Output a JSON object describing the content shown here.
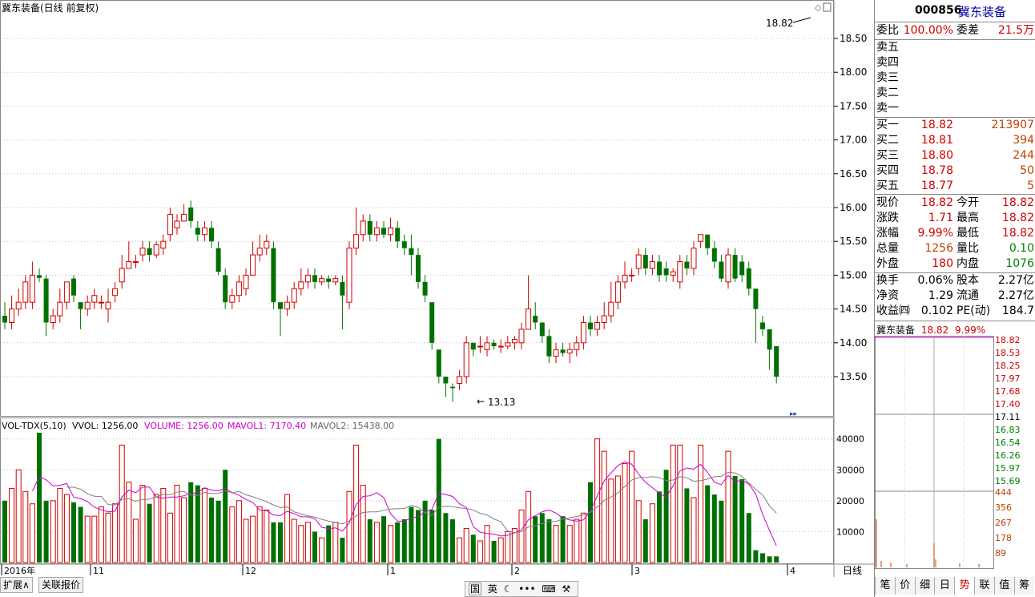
{
  "chart_title": "冀东装备(日线 前复权)",
  "vol_header": {
    "indicator": "VOL-TDX(5,10)",
    "vvol": "VVOL: 1256.00",
    "volume": "VOLUME: 1256.00",
    "mavol1": "MAVOL1: 7170.40",
    "mavol2": "MAVOL2: 15438.00"
  },
  "colors": {
    "up": "#d00000",
    "down": "#007000",
    "ma1": "#cc00cc",
    "ma2": "#808080",
    "grid": "#bfbfbf"
  },
  "price_axis": [
    "18.50",
    "18.00",
    "17.50",
    "17.00",
    "16.50",
    "16.00",
    "15.50",
    "15.00",
    "14.50",
    "14.00",
    "13.50"
  ],
  "vol_axis": [
    "40000",
    "30000",
    "20000",
    "10000"
  ],
  "time_axis": [
    "2016年",
    "11",
    "12",
    "1",
    "2",
    "3",
    "4"
  ],
  "period_label": "日线",
  "annotations": {
    "high": "18.82",
    "low": "13.13"
  },
  "chart_data": {
    "type": "candlestick",
    "ylim": [
      13.1,
      18.9
    ],
    "candles": [
      [
        14.4,
        14.3,
        14.6,
        14.2
      ],
      [
        14.3,
        14.5,
        14.7,
        14.2
      ],
      [
        14.5,
        14.6,
        14.8,
        14.4
      ],
      [
        14.6,
        14.9,
        15.0,
        14.5
      ],
      [
        14.6,
        15.0,
        15.2,
        14.5
      ],
      [
        15.0,
        14.96,
        15.1,
        14.9
      ],
      [
        14.95,
        14.3,
        15.0,
        14.1
      ],
      [
        14.3,
        14.4,
        14.5,
        14.2
      ],
      [
        14.4,
        14.6,
        14.8,
        14.3
      ],
      [
        14.6,
        14.9,
        14.9,
        14.5
      ],
      [
        14.95,
        14.7,
        15.0,
        14.6
      ],
      [
        14.6,
        14.5,
        14.6,
        14.2
      ],
      [
        14.5,
        14.6,
        14.7,
        14.4
      ],
      [
        14.6,
        14.7,
        14.8,
        14.5
      ],
      [
        14.6,
        14.6,
        14.7,
        14.5
      ],
      [
        14.5,
        14.6,
        14.8,
        14.3
      ],
      [
        14.7,
        14.8,
        14.9,
        14.6
      ],
      [
        14.9,
        15.1,
        15.3,
        14.8
      ],
      [
        15.1,
        15.2,
        15.5,
        15.1
      ],
      [
        15.2,
        15.2,
        15.3,
        15.1
      ],
      [
        15.3,
        15.4,
        15.5,
        15.2
      ],
      [
        15.4,
        15.3,
        15.5,
        15.2
      ],
      [
        15.3,
        15.45,
        15.5,
        15.25
      ],
      [
        15.4,
        15.5,
        15.6,
        15.3
      ],
      [
        15.6,
        15.9,
        16.0,
        15.5
      ],
      [
        15.7,
        15.8,
        15.9,
        15.6
      ],
      [
        15.8,
        15.9,
        16.05,
        15.8
      ],
      [
        16.0,
        15.8,
        16.1,
        15.7
      ],
      [
        15.7,
        15.6,
        15.8,
        15.5
      ],
      [
        15.6,
        15.7,
        15.8,
        15.5
      ],
      [
        15.7,
        15.5,
        15.8,
        15.4
      ],
      [
        15.4,
        15.05,
        15.5,
        15.0
      ],
      [
        15.0,
        14.6,
        15.1,
        14.5
      ],
      [
        14.6,
        14.7,
        14.8,
        14.5
      ],
      [
        14.7,
        14.9,
        15.0,
        14.6
      ],
      [
        14.8,
        15.0,
        15.1,
        14.7
      ],
      [
        15.0,
        15.3,
        15.5,
        15.0
      ],
      [
        15.3,
        15.4,
        15.6,
        15.2
      ],
      [
        15.4,
        15.5,
        15.6,
        15.3
      ],
      [
        15.4,
        14.6,
        15.5,
        14.5
      ],
      [
        14.6,
        14.5,
        14.6,
        14.1
      ],
      [
        14.5,
        14.6,
        14.7,
        14.4
      ],
      [
        14.6,
        14.8,
        14.9,
        14.5
      ],
      [
        14.8,
        14.9,
        15.1,
        14.7
      ],
      [
        14.9,
        15.0,
        15.1,
        14.8
      ],
      [
        15.0,
        14.9,
        15.1,
        14.8
      ],
      [
        14.9,
        14.95,
        15.0,
        14.85
      ],
      [
        14.95,
        14.9,
        15.0,
        14.8
      ],
      [
        14.9,
        14.95,
        15.0,
        14.85
      ],
      [
        14.9,
        14.7,
        15.0,
        14.2
      ],
      [
        14.6,
        15.4,
        15.5,
        14.5
      ],
      [
        15.4,
        15.6,
        16.0,
        15.3
      ],
      [
        15.6,
        15.8,
        15.9,
        15.5
      ],
      [
        15.8,
        15.6,
        15.9,
        15.5
      ],
      [
        15.6,
        15.7,
        15.8,
        15.5
      ],
      [
        15.7,
        15.6,
        15.8,
        15.55
      ],
      [
        15.6,
        15.7,
        15.85,
        15.5
      ],
      [
        15.7,
        15.5,
        15.8,
        15.4
      ],
      [
        15.5,
        15.4,
        15.6,
        15.3
      ],
      [
        15.4,
        15.3,
        15.6,
        15.0
      ],
      [
        15.3,
        14.9,
        15.4,
        14.8
      ],
      [
        14.9,
        14.7,
        15.0,
        14.6
      ],
      [
        14.6,
        14.0,
        14.6,
        13.9
      ],
      [
        13.9,
        13.5,
        13.9,
        13.4
      ],
      [
        13.5,
        13.4,
        13.5,
        13.2
      ],
      [
        13.35,
        13.33,
        13.4,
        13.13
      ],
      [
        13.4,
        13.5,
        13.6,
        13.3
      ],
      [
        13.5,
        14.0,
        14.1,
        13.4
      ],
      [
        14.0,
        13.9,
        14.0,
        13.8
      ],
      [
        13.95,
        13.95,
        14.1,
        13.85
      ],
      [
        13.9,
        14.0,
        14.1,
        13.8
      ],
      [
        14.0,
        13.95,
        14.05,
        13.9
      ],
      [
        13.95,
        13.95,
        14.05,
        13.85
      ],
      [
        13.95,
        14.0,
        14.1,
        13.9
      ],
      [
        14.0,
        14.05,
        14.1,
        13.9
      ],
      [
        14.0,
        14.2,
        14.3,
        13.9
      ],
      [
        14.2,
        14.5,
        15.0,
        14.2
      ],
      [
        14.4,
        14.3,
        14.6,
        14.2
      ],
      [
        14.3,
        14.1,
        14.3,
        14.0
      ],
      [
        14.1,
        13.8,
        14.2,
        13.7
      ],
      [
        13.8,
        13.9,
        14.0,
        13.7
      ],
      [
        13.9,
        13.85,
        14.0,
        13.8
      ],
      [
        13.85,
        13.9,
        14.0,
        13.7
      ],
      [
        13.9,
        14.0,
        14.1,
        13.8
      ],
      [
        14.0,
        14.3,
        14.4,
        13.9
      ],
      [
        14.3,
        14.2,
        14.4,
        14.1
      ],
      [
        14.2,
        14.3,
        14.4,
        14.1
      ],
      [
        14.3,
        14.4,
        14.6,
        14.2
      ],
      [
        14.4,
        14.6,
        14.9,
        14.3
      ],
      [
        14.6,
        14.9,
        15.0,
        14.5
      ],
      [
        14.9,
        15.0,
        15.2,
        14.8
      ],
      [
        15.0,
        15.0,
        15.1,
        14.9
      ],
      [
        15.1,
        15.3,
        15.4,
        15.0
      ],
      [
        15.3,
        15.1,
        15.4,
        15.0
      ],
      [
        15.1,
        15.2,
        15.3,
        15.0
      ],
      [
        15.2,
        15.0,
        15.3,
        14.9
      ],
      [
        15.1,
        15.0,
        15.2,
        14.9
      ],
      [
        15.0,
        15.05,
        15.1,
        14.9
      ],
      [
        14.9,
        15.2,
        15.3,
        14.8
      ],
      [
        15.2,
        15.1,
        15.3,
        15.0
      ],
      [
        15.1,
        15.4,
        15.5,
        15.0
      ],
      [
        15.5,
        15.6,
        15.6,
        15.4
      ],
      [
        15.6,
        15.4,
        15.6,
        15.3
      ],
      [
        15.4,
        15.2,
        15.5,
        15.1
      ],
      [
        15.2,
        14.95,
        15.3,
        14.9
      ],
      [
        14.9,
        15.3,
        15.4,
        14.8
      ],
      [
        15.3,
        14.95,
        15.4,
        14.9
      ],
      [
        15.2,
        15.0,
        15.3,
        14.9
      ],
      [
        15.1,
        14.8,
        15.2,
        14.7
      ],
      [
        14.8,
        14.5,
        14.8,
        14.0
      ],
      [
        14.3,
        14.2,
        14.4,
        14.1
      ],
      [
        14.2,
        13.9,
        14.2,
        13.6
      ],
      [
        13.95,
        13.5,
        13.9,
        13.4
      ]
    ],
    "volume": [
      20000,
      24000,
      30000,
      23000,
      19000,
      42000,
      20000,
      20000,
      24000,
      22000,
      19500,
      18000,
      15000,
      15000,
      18000,
      16000,
      19000,
      38000,
      26000,
      14000,
      25000,
      19000,
      22000,
      24000,
      16000,
      25000,
      21000,
      26000,
      25000,
      24000,
      21000,
      20000,
      30000,
      18000,
      20000,
      14000,
      15000,
      18000,
      17000,
      13000,
      13000,
      22000,
      14000,
      12000,
      13000,
      10000,
      8000,
      12000,
      13000,
      8000,
      23000,
      38000,
      25000,
      14000,
      13000,
      15000,
      12000,
      13000,
      14000,
      18000,
      17000,
      20000,
      17000,
      40000,
      16000,
      14000,
      8000,
      11000,
      9000,
      7000,
      12000,
      7000,
      8000,
      10000,
      11000,
      17000,
      23000,
      15000,
      16000,
      14000,
      12000,
      15000,
      12000,
      14000,
      16000,
      26000,
      40000,
      36000,
      27000,
      28000,
      32000,
      36000,
      20000,
      14000,
      19000,
      23000,
      30000,
      38000,
      38000,
      24000,
      21000,
      38000,
      25000,
      22000,
      20000,
      36000,
      28000,
      27000,
      16000,
      4000,
      3000,
      2000,
      2000
    ]
  },
  "sidebar": {
    "code": "000856",
    "name": "冀东装备",
    "weibi_label": "委比",
    "weibi_value": "100.00%",
    "weicha_label": "委差",
    "weicha_value": "21.5万",
    "sell_levels": [
      "卖五",
      "卖四",
      "卖三",
      "卖二",
      "卖一"
    ],
    "buy_levels": [
      {
        "label": "买一",
        "price": "18.82",
        "vol": "213907"
      },
      {
        "label": "买二",
        "price": "18.81",
        "vol": "394"
      },
      {
        "label": "买三",
        "price": "18.80",
        "vol": "244"
      },
      {
        "label": "买四",
        "price": "18.78",
        "vol": "50"
      },
      {
        "label": "买五",
        "price": "18.77",
        "vol": "5"
      }
    ],
    "quote": [
      {
        "l1": "现价",
        "v1": "18.82",
        "l2": "今开",
        "v2": "18.82"
      },
      {
        "l1": "涨跌",
        "v1": "1.71",
        "l2": "最高",
        "v2": "18.82"
      },
      {
        "l1": "涨幅",
        "v1": "9.99%",
        "l2": "最低",
        "v2": "18.82"
      },
      {
        "l1": "总量",
        "v1": "1256",
        "l2": "量比",
        "v2": "0.10"
      },
      {
        "l1": "外盘",
        "v1": "180",
        "l2": "内盘",
        "v2": "1076"
      }
    ],
    "finance": [
      {
        "l1": "换手",
        "v1": "0.06%",
        "l2": "股本",
        "v2": "2.27亿"
      },
      {
        "l1": "净资",
        "v1": "1.29",
        "l2": "流通",
        "v2": "2.27亿"
      },
      {
        "l1": "收益㈣",
        "v1": "0.102",
        "l2": "PE(动)",
        "v2": "184.7"
      }
    ],
    "mini_title": "冀东装备",
    "mini_price": "18.82",
    "mini_pct": "9.99%",
    "mini_price_axis": [
      "18.82",
      "18.53",
      "18.25",
      "17.97",
      "17.68",
      "17.40",
      "17.11",
      "16.83",
      "16.54",
      "16.26",
      "15.97",
      "15.69"
    ],
    "mini_vol_axis": [
      "444",
      "356",
      "267",
      "178",
      "89"
    ],
    "tabs": [
      "笔",
      "价",
      "细",
      "日",
      "势",
      "联",
      "值",
      "筹"
    ]
  },
  "bottom": {
    "buttons": [
      "扩展∧",
      "关联报价"
    ],
    "toolbar": [
      "国",
      "英"
    ]
  }
}
